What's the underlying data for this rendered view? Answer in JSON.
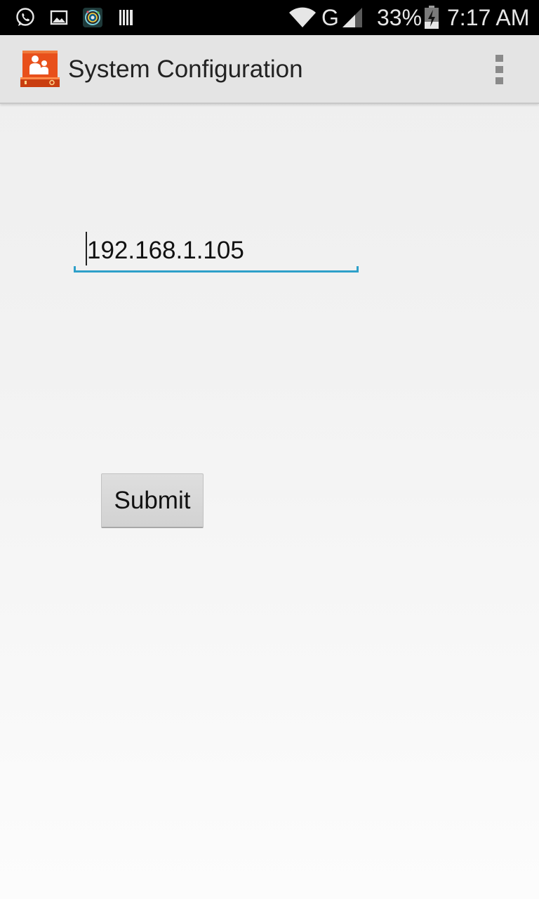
{
  "status_bar": {
    "left_icons": [
      "whatsapp-icon",
      "gallery-icon",
      "camera-app-icon",
      "barcode-icon"
    ],
    "network_type": "G",
    "battery_percent": "33%",
    "time": "7:17 AM",
    "battery_level": 0.33,
    "battery_charging": true
  },
  "action_bar": {
    "title": "System Configuration",
    "app_icon": "system-config-app-icon",
    "menu_icon": "overflow-menu-icon"
  },
  "form": {
    "ip_value": "192.168.1.105",
    "submit_label": "Submit"
  },
  "colors": {
    "accent": "#2ea0c9",
    "app_icon_orange": "#e8501b",
    "action_bar_bg": "#e4e4e4",
    "status_bar_bg": "#000000"
  }
}
